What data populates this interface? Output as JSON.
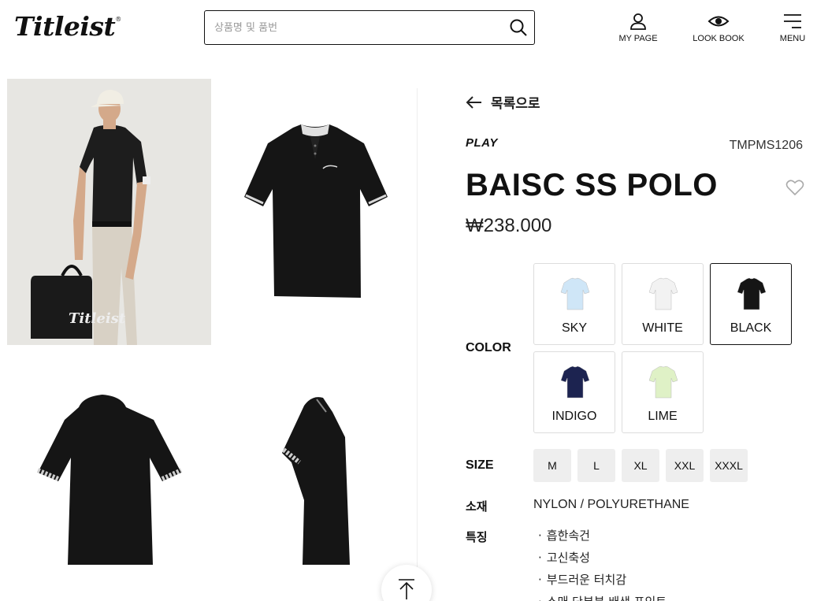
{
  "header": {
    "logo": "Titleist",
    "logo_mark": "®",
    "search_placeholder": "상품명 및 품번",
    "nav": [
      {
        "label": "MY PAGE",
        "icon": "person-icon"
      },
      {
        "label": "LOOK BOOK",
        "icon": "eye-icon"
      },
      {
        "label": "MENU",
        "icon": "hamburger-icon"
      }
    ]
  },
  "product": {
    "back_label": "목록으로",
    "brand": "PLAY",
    "code": "TMPMS1206",
    "name": "BAISC SS POLO",
    "price": "₩238.000",
    "color_label": "COLOR",
    "colors": [
      {
        "name": "SKY",
        "hex": "#cfe6f7",
        "selected": false
      },
      {
        "name": "WHITE",
        "hex": "#f2f2f2",
        "selected": false
      },
      {
        "name": "BLACK",
        "hex": "#151515",
        "selected": true
      },
      {
        "name": "INDIGO",
        "hex": "#1c2350",
        "selected": false
      },
      {
        "name": "LIME",
        "hex": "#dff1c6",
        "selected": false
      }
    ],
    "size_label": "SIZE",
    "sizes": [
      "M",
      "L",
      "XL",
      "XXL",
      "XXXL"
    ],
    "material_label": "소재",
    "material": "NYLON / POLYURETHANE",
    "feature_label": "특징",
    "features": [
      "흡한속건",
      "고신축성",
      "부드러운 터치감",
      "소매 단부분 배색 포인트"
    ]
  },
  "gallery": {
    "images": [
      "model-photo",
      "front-view",
      "back-view",
      "side-view"
    ],
    "bag_text": "Titleist"
  }
}
